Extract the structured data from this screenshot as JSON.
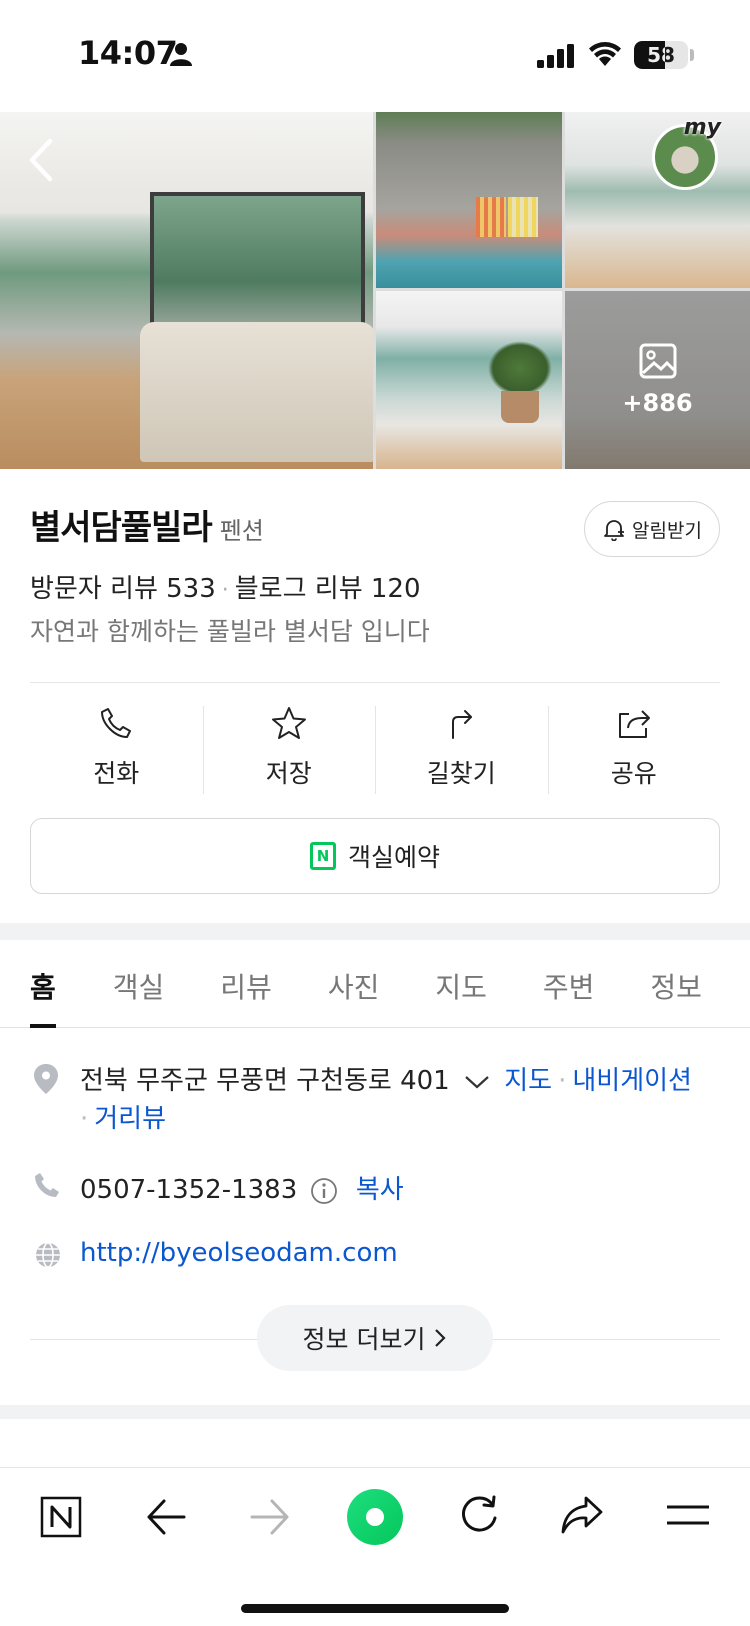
{
  "status_bar": {
    "time": "14:07",
    "battery": "58",
    "battery_level": 0.58
  },
  "place": {
    "name": "별서담풀빌라",
    "category": "펜션",
    "alarm_label": "알림받기",
    "visitor_reviews_label": "방문자 리뷰 533",
    "blog_reviews_label": "블로그 리뷰 120",
    "description": "자연과 함께하는 풀빌라 별서담 입니다"
  },
  "gallery": {
    "more_count": "+886",
    "badge_text": "my"
  },
  "actions": [
    {
      "label": "전화",
      "icon": "phone-icon"
    },
    {
      "label": "저장",
      "icon": "star-icon"
    },
    {
      "label": "길찾기",
      "icon": "directions-icon"
    },
    {
      "label": "공유",
      "icon": "share-icon"
    }
  ],
  "reserve": {
    "label": "객실예약",
    "icon_letter": "N"
  },
  "tabs": [
    "홈",
    "객실",
    "리뷰",
    "사진",
    "지도",
    "주변",
    "정보"
  ],
  "active_tab": "홈",
  "info": {
    "address": "전북 무주군 무풍면 구천동로 401",
    "map_link": "지도",
    "navi_link": "내비게이션",
    "street_view_link": "거리뷰",
    "phone": "0507-1352-1383",
    "copy_link": "복사",
    "website": "http://byeolseodam.com",
    "more_label": "정보 더보기"
  },
  "colors": {
    "link": "#0b57d0",
    "naver_green": "#03c75a"
  }
}
